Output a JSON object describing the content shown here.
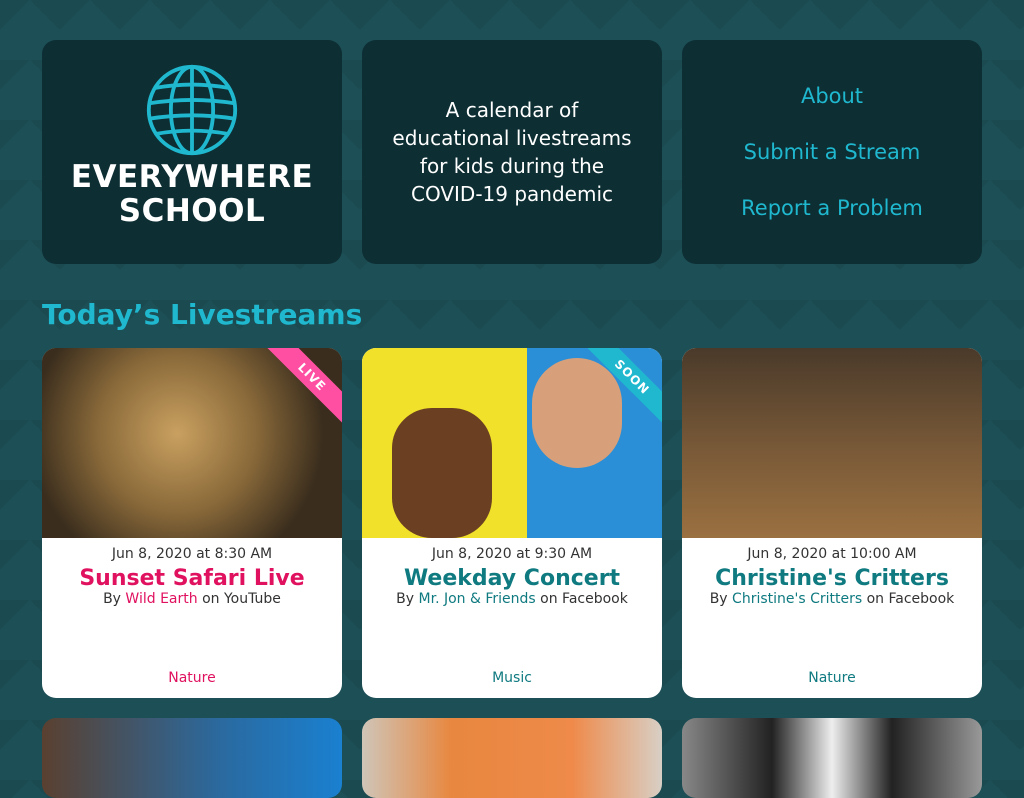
{
  "logo": {
    "line1": "EVERYWHERE",
    "line2": "SCHOOL"
  },
  "tagline": "A calendar of educational livestreams for kids during the COVID-19 pandemic",
  "nav": [
    "About",
    "Submit a Stream",
    "Report a Problem"
  ],
  "section_title": "Today’s Livestreams",
  "cards": [
    {
      "badge": "LIVE",
      "date": "Jun 8, 2020 at 8:30 AM",
      "title": "Sunset Safari Live",
      "by": "By",
      "author": "Wild Earth",
      "platform": "on YouTube",
      "category": "Nature"
    },
    {
      "badge": "SOON",
      "date": "Jun 8, 2020 at 9:30 AM",
      "title": "Weekday Concert",
      "by": "By",
      "author": "Mr. Jon & Friends",
      "platform": "on Facebook",
      "category": "Music"
    },
    {
      "date": "Jun 8, 2020 at 10:00 AM",
      "title": "Christine's Critters",
      "by": "By",
      "author": "Christine's Critters",
      "platform": "on Facebook",
      "category": "Nature"
    }
  ],
  "colors": {
    "accent": "#1fb8cf",
    "live": "#e0115f",
    "teal": "#0f7a80"
  }
}
